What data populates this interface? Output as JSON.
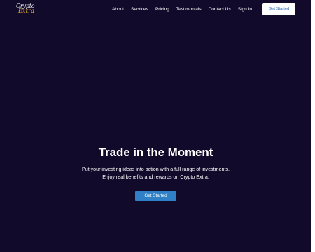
{
  "brand": {
    "logo_top": "Crypto",
    "logo_bottom": "Extra"
  },
  "nav": {
    "links": [
      "About",
      "Services",
      "Pricing",
      "Testimonials",
      "Contact Us",
      "Sign In"
    ],
    "cta": "Get Started"
  },
  "hero": {
    "title": "Trade in the Moment",
    "line1": "Put your investing ideas into action with a full range of investments.",
    "line2": "Enjoy real benefits and rewards on Crypto Extra.",
    "cta": "Get Started"
  },
  "colors": {
    "background": "#120a2b",
    "accent": "#2f80c6",
    "logo_gold": "#f2b233"
  }
}
